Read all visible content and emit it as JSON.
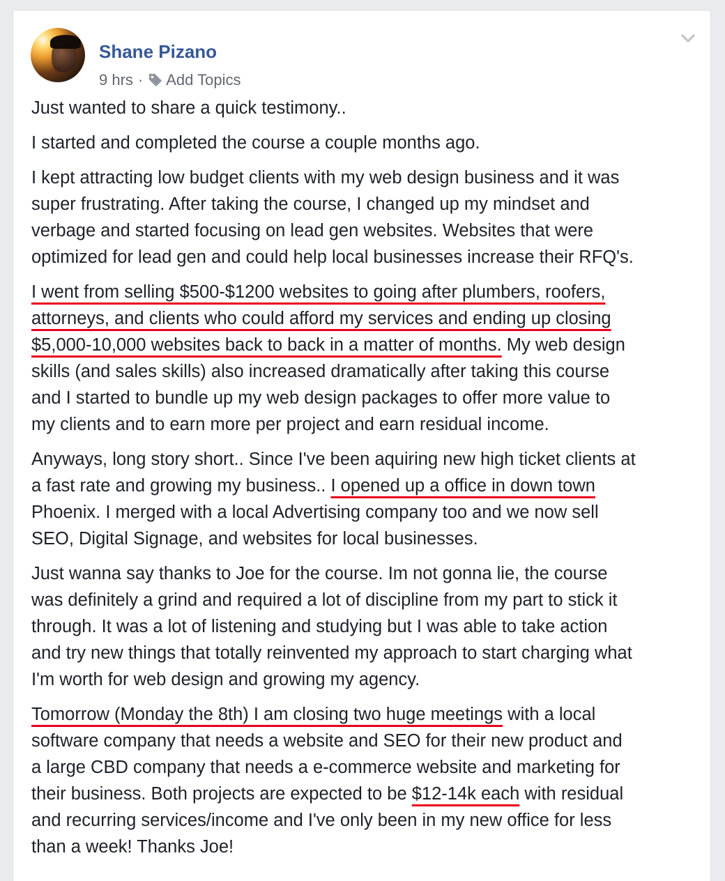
{
  "post": {
    "author": "Shane Pizano",
    "time": "9 hrs",
    "separator": "·",
    "add_topics": "Add Topics",
    "icons": {
      "tag": "tag-icon",
      "menu": "chevron-down-icon"
    },
    "colors": {
      "author": "#365899",
      "underline": "#e8001c",
      "text": "#1d2129",
      "meta": "#616770"
    },
    "paragraphs": [
      [
        "Just wanted to share a quick testimony.."
      ],
      [
        "I started and completed the course a couple months ago."
      ],
      [
        "I kept attracting low budget clients with my web design business and it was",
        "super frustrating. After taking the course, I changed up my mindset and",
        "verbage and started focusing on lead gen websites. Websites that were",
        "optimized for lead gen and could help local businesses increase their RFQ's."
      ],
      [
        "I went from selling $500-$1200 websites to going after plumbers, roofers,",
        "attorneys, and clients who could afford my services and ending up closing",
        "$5,000-10,000 websites back to back in a matter of months.",
        " My web design",
        "skills (and sales skills) also increased dramatically after taking this course",
        "and I started to bundle up my web design packages to offer more value to",
        "my clients and to earn more per project and earn residual income."
      ],
      [
        "Anyways, long story short.. Since I've been aquiring new high ticket clients at",
        "a fast rate and growing my business.. ",
        "I opened up a office in down town",
        "Phoenix. I merged with a local Advertising company too and we now sell",
        "SEO, Digital Signage, and websites for local businesses."
      ],
      [
        "Just wanna say thanks to Joe for the course. Im not gonna lie, the course",
        "was definitely a grind and required a lot of discipline from my part to stick it",
        "through. It was a lot of listening and studying but I was able to take action",
        "and try new things that totally reinvented my approach to start charging what",
        "I'm worth for web design and growing my agency."
      ],
      [
        "Tomorrow (Monday the 8th) I am closing two huge meetings",
        " with a local",
        "software company that needs a website and SEO for their new product and",
        "a large CBD company that needs a e-commerce website and marketing for",
        "their business. Both projects are expected to be ",
        "$12-14k each",
        " with residual",
        "and recurring services/income and I've only been in my new office for less",
        "than a week! Thanks Joe!"
      ]
    ]
  }
}
